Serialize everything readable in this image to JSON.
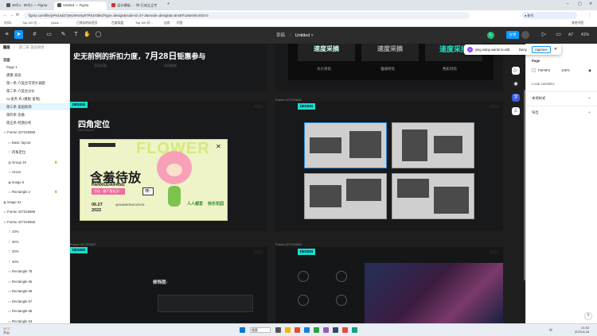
{
  "browser": {
    "tabs": [
      {
        "label": "28号1 · 95号1 — Figma"
      },
      {
        "label": "Untitled — Figma"
      },
      {
        "label": "设计模板... · 特·已成立立专"
      }
    ],
    "new_tab": "+",
    "url": "figma.com/file/jxPe2a4i27y6UWxn5y0TR/Untitled?type=design&node-id=47-2&mode=design&t=6nvEFu2weSKnOGt-0",
    "bookmarks": [
      "访问1",
      "Top 100 位 ...",
      "Quick ...",
      "已保存的标签页",
      "百度网盘",
      "Top 100 问 ...",
      "自用",
      "阿里",
      "其他书签"
    ]
  },
  "figma": {
    "file_title": "草稿 / Untitled",
    "draft_label": "草稿",
    "untitled_label": "Untitled",
    "share_label": "分享",
    "zoom": "41%",
    "avatar_initial": "L",
    "toolbar_letters": "A7"
  },
  "notification": {
    "name": "ying wang",
    "text": "ying wang wants to edit",
    "deny": "Deny",
    "approve": "Approve"
  },
  "layers": {
    "tabs": [
      "图层",
      "第二条·美国商场 "
    ],
    "pages_header": "页面",
    "pages": [
      "Page 1",
      "建模·高段",
      "第一条·六美台可测大调题",
      "第二条·六美台分价",
      "AI·家务·布 (模板·复制)",
      "第三条·美国商场",
      "第四条·金融",
      "第五条·经期分析"
    ],
    "items": [
      {
        "label": "Frame 427319688",
        "icon": "#"
      },
      {
        "label": "Basic layout",
        "icon": "▭"
      },
      {
        "label": "四角定位",
        "icon": "T"
      },
      {
        "label": "Group 16",
        "icon": "▦"
      },
      {
        "label": "Union",
        "icon": "◇"
      },
      {
        "label": "image 6",
        "icon": "▣"
      },
      {
        "label": "Rectangle 2",
        "icon": "▭"
      },
      {
        "label": "image 24",
        "icon": "▣"
      },
      {
        "label": "Frame 427319686",
        "icon": "#"
      },
      {
        "label": "Frame 427319655",
        "icon": "#"
      },
      {
        "label": "10%",
        "icon": "T"
      },
      {
        "label": "30%",
        "icon": "T"
      },
      {
        "label": "20%",
        "icon": "T"
      },
      {
        "label": "30%",
        "icon": "T"
      },
      {
        "label": "Rectangle 78",
        "icon": "▭"
      },
      {
        "label": "Rectangle 66",
        "icon": "▭"
      },
      {
        "label": "Rectangle 69",
        "icon": "▭"
      },
      {
        "label": "Rectangle 67",
        "icon": "▭"
      },
      {
        "label": "Rectangle 68",
        "icon": "▭"
      },
      {
        "label": "Rectangle 63",
        "icon": "▭"
      }
    ]
  },
  "canvas": {
    "top_left_text": "史无前例的折扣力度，",
    "top_left_date": "7月28日",
    "top_left_tail": "钜惠参与",
    "top_left_sub1": "活动页面",
    "top_left_sub2": "时间描述",
    "top_right_cards": [
      "速度采摘",
      "速度采摘",
      "速度采摘"
    ],
    "top_right_labels": [
      "大小对比",
      "强弱对比",
      "色彩对比"
    ],
    "frame_tag": "DESIGN",
    "year": "2023",
    "frame2_title": "四角定位",
    "frame2_sub": "Best layout",
    "poster_flower": "FLOWER",
    "poster_main": "含羞待放",
    "poster_pinyin": "HANXIUDAIFANG",
    "poster_tag": "活动 · 跟个朋友见！",
    "poster_date": "06.27",
    "poster_year": "2022",
    "poster_bubble": "咦~",
    "poster_slogan1": "人人都爱",
    "poster_slogan2": "快乐花园",
    "poster_url": "@SUMMERVACATION",
    "frame3_label": "Frame 427319686",
    "frame4_text": "修饰层:",
    "frame4_label": "Frame 427319687",
    "frame5_label": "Frame 427319688"
  },
  "right_panel": {
    "tabs": [
      "设计",
      "原型"
    ],
    "page_label": "Page",
    "color_value": "F5F5F5",
    "color_opacity": "100%",
    "local_variables": "Local variables",
    "local_styles": "本地样式",
    "export": "导出"
  },
  "taskbar": {
    "weather": "26°C",
    "weather_sub": "多云",
    "search": "搜索",
    "time": "21:02",
    "date": "2023-8-16",
    "lang": "中"
  },
  "colors": {
    "accent": "#0d99ff",
    "tag": "#17e0c8",
    "approve_border": "#0d99ff"
  }
}
